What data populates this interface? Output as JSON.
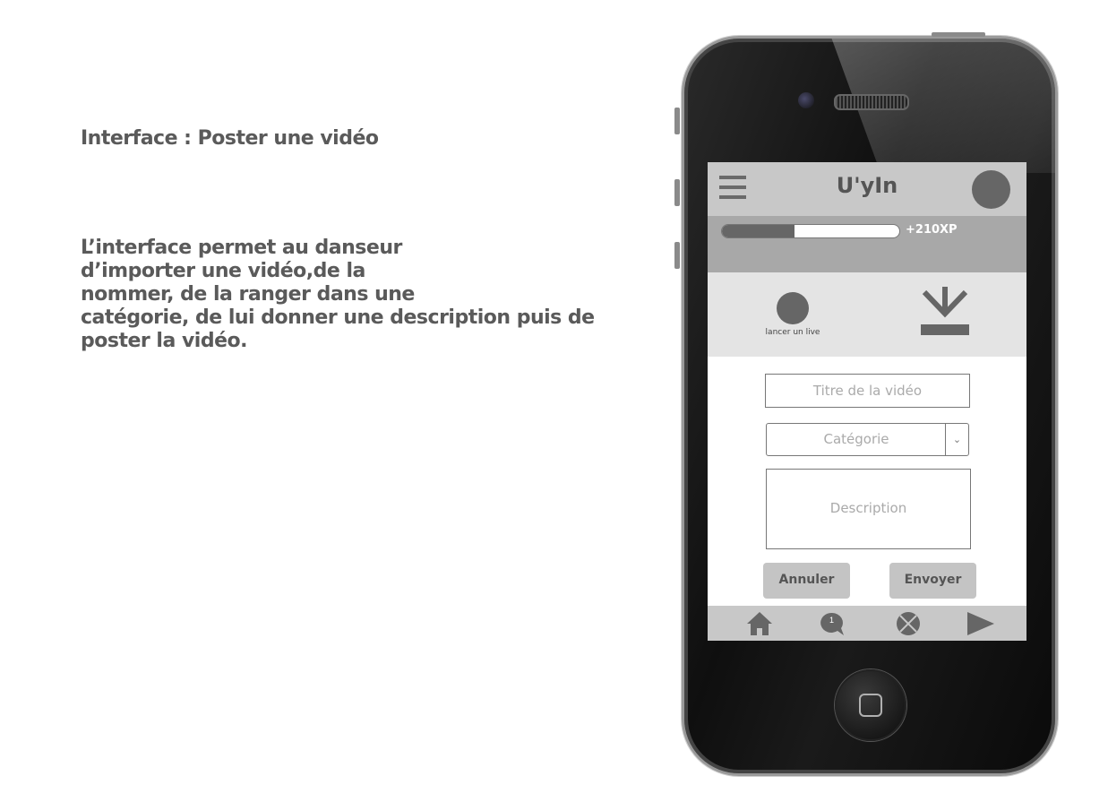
{
  "page": {
    "title": "Interface : Poster une vidéo",
    "description_lines": [
      "L’interface permet au danseur",
      "d’importer une vidéo,de la",
      "nommer, de la ranger dans une",
      "catégorie, de lui donner une description puis de",
      "poster la vidéo."
    ]
  },
  "app": {
    "name": "U'yIn",
    "xp": {
      "label": "+210XP",
      "progress_fraction": 0.41
    },
    "actions": {
      "live_label": "lancer un live"
    },
    "form": {
      "title_placeholder": "Titre de la vidéo",
      "category_placeholder": "Catégorie",
      "description_placeholder": "Description",
      "cancel_label": "Annuler",
      "send_label": "Envoyer"
    },
    "tabbar": {
      "notification_count": "1"
    }
  },
  "colors": {
    "text_gray": "#5a5a5a",
    "header_gray": "#c8c8c8",
    "xp_band": "#a8a8a8",
    "accent_dark": "#666666"
  }
}
